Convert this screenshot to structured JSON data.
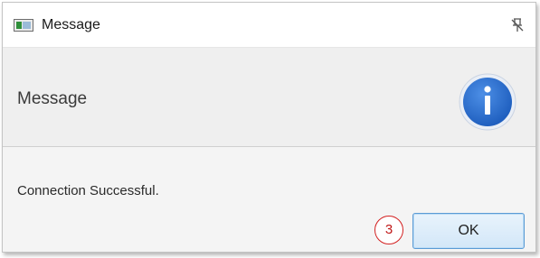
{
  "window": {
    "title": "Message",
    "icon": "app-window-icon",
    "pin_icon": "pin-off-icon"
  },
  "header": {
    "text": "Message",
    "icon": "info-icon",
    "icon_glyph": "i",
    "icon_color": "#2a6fd0"
  },
  "content": {
    "message": "Connection Successful."
  },
  "buttons": {
    "ok_label": "OK"
  },
  "annotation": {
    "step_number": "3",
    "color": "#d32020"
  }
}
